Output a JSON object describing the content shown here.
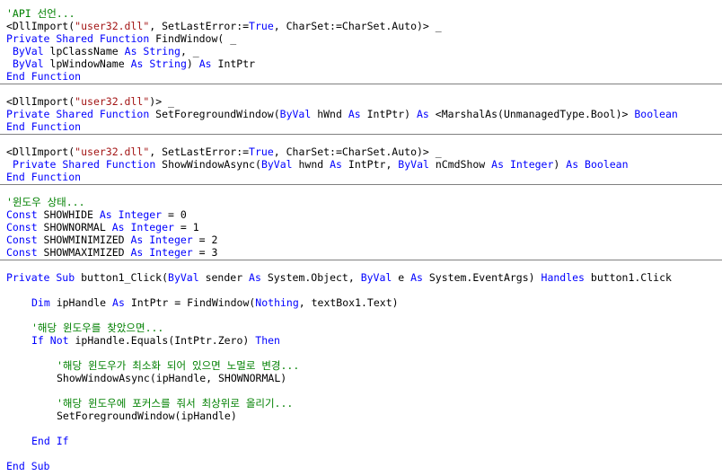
{
  "colors": {
    "background": "#ffffff",
    "keyword": "#0000ff",
    "string": "#a31515",
    "comment": "#008000",
    "text": "#000000",
    "separator": "#808080"
  },
  "lines": [
    {
      "indent": 0,
      "tokens": [
        {
          "t": "cm",
          "v": "'API 선언..."
        }
      ]
    },
    {
      "indent": 0,
      "tokens": [
        {
          "t": "txt",
          "v": "<DllImport("
        },
        {
          "t": "str",
          "v": "\"user32.dll\""
        },
        {
          "t": "txt",
          "v": ", SetLastError:="
        },
        {
          "t": "kw",
          "v": "True"
        },
        {
          "t": "txt",
          "v": ", CharSet:=CharSet.Auto)> _"
        }
      ]
    },
    {
      "indent": 0,
      "tokens": [
        {
          "t": "kw",
          "v": "Private Shared Function"
        },
        {
          "t": "txt",
          "v": " FindWindow( _"
        }
      ]
    },
    {
      "indent": 1,
      "tokens": [
        {
          "t": "kw",
          "v": "ByVal"
        },
        {
          "t": "txt",
          "v": " lpClassName "
        },
        {
          "t": "kw",
          "v": "As String"
        },
        {
          "t": "txt",
          "v": ", _"
        }
      ]
    },
    {
      "indent": 1,
      "tokens": [
        {
          "t": "kw",
          "v": "ByVal"
        },
        {
          "t": "txt",
          "v": " lpWindowName "
        },
        {
          "t": "kw",
          "v": "As String"
        },
        {
          "t": "txt",
          "v": ") "
        },
        {
          "t": "kw",
          "v": "As"
        },
        {
          "t": "txt",
          "v": " IntPtr"
        }
      ]
    },
    {
      "indent": 0,
      "tokens": [
        {
          "t": "kw",
          "v": "End Function"
        }
      ]
    },
    {
      "indent": 0,
      "tokens": []
    },
    {
      "indent": 0,
      "tokens": [
        {
          "t": "txt",
          "v": "<DllImport("
        },
        {
          "t": "str",
          "v": "\"user32.dll\""
        },
        {
          "t": "txt",
          "v": ")> _"
        }
      ]
    },
    {
      "indent": 0,
      "tokens": [
        {
          "t": "kw",
          "v": "Private Shared Function"
        },
        {
          "t": "txt",
          "v": " SetForegroundWindow("
        },
        {
          "t": "kw",
          "v": "ByVal"
        },
        {
          "t": "txt",
          "v": " hWnd "
        },
        {
          "t": "kw",
          "v": "As"
        },
        {
          "t": "txt",
          "v": " IntPtr) "
        },
        {
          "t": "kw",
          "v": "As"
        },
        {
          "t": "txt",
          "v": " <MarshalAs(UnmanagedType.Bool)> "
        },
        {
          "t": "kw",
          "v": "Boolean"
        }
      ]
    },
    {
      "indent": 0,
      "tokens": [
        {
          "t": "kw",
          "v": "End Function"
        }
      ]
    },
    {
      "indent": 0,
      "tokens": []
    },
    {
      "indent": 0,
      "tokens": [
        {
          "t": "txt",
          "v": "<DllImport("
        },
        {
          "t": "str",
          "v": "\"user32.dll\""
        },
        {
          "t": "txt",
          "v": ", SetLastError:="
        },
        {
          "t": "kw",
          "v": "True"
        },
        {
          "t": "txt",
          "v": ", CharSet:=CharSet.Auto)> _"
        }
      ]
    },
    {
      "indent": 1,
      "tokens": [
        {
          "t": "kw",
          "v": "Private Shared Function"
        },
        {
          "t": "txt",
          "v": " ShowWindowAsync("
        },
        {
          "t": "kw",
          "v": "ByVal"
        },
        {
          "t": "txt",
          "v": " hwnd "
        },
        {
          "t": "kw",
          "v": "As"
        },
        {
          "t": "txt",
          "v": " IntPtr, "
        },
        {
          "t": "kw",
          "v": "ByVal"
        },
        {
          "t": "txt",
          "v": " nCmdShow "
        },
        {
          "t": "kw",
          "v": "As Integer"
        },
        {
          "t": "txt",
          "v": ") "
        },
        {
          "t": "kw",
          "v": "As Boolean"
        }
      ]
    },
    {
      "indent": 0,
      "tokens": [
        {
          "t": "kw",
          "v": "End Function"
        }
      ]
    },
    {
      "indent": 0,
      "tokens": []
    },
    {
      "indent": 0,
      "tokens": [
        {
          "t": "cm",
          "v": "'윈도우 상태..."
        }
      ]
    },
    {
      "indent": 0,
      "tokens": [
        {
          "t": "kw",
          "v": "Const"
        },
        {
          "t": "txt",
          "v": " SHOWHIDE "
        },
        {
          "t": "kw",
          "v": "As Integer"
        },
        {
          "t": "txt",
          "v": " = 0"
        }
      ]
    },
    {
      "indent": 0,
      "tokens": [
        {
          "t": "kw",
          "v": "Const"
        },
        {
          "t": "txt",
          "v": " SHOWNORMAL "
        },
        {
          "t": "kw",
          "v": "As Integer"
        },
        {
          "t": "txt",
          "v": " = 1"
        }
      ]
    },
    {
      "indent": 0,
      "tokens": [
        {
          "t": "kw",
          "v": "Const"
        },
        {
          "t": "txt",
          "v": " SHOWMINIMIZED "
        },
        {
          "t": "kw",
          "v": "As Integer"
        },
        {
          "t": "txt",
          "v": " = 2"
        }
      ]
    },
    {
      "indent": 0,
      "tokens": [
        {
          "t": "kw",
          "v": "Const"
        },
        {
          "t": "txt",
          "v": " SHOWMAXIMIZED "
        },
        {
          "t": "kw",
          "v": "As Integer"
        },
        {
          "t": "txt",
          "v": " = 3"
        }
      ]
    },
    {
      "indent": 0,
      "tokens": []
    },
    {
      "indent": 0,
      "tokens": [
        {
          "t": "kw",
          "v": "Private Sub"
        },
        {
          "t": "txt",
          "v": " button1_Click("
        },
        {
          "t": "kw",
          "v": "ByVal"
        },
        {
          "t": "txt",
          "v": " sender "
        },
        {
          "t": "kw",
          "v": "As"
        },
        {
          "t": "txt",
          "v": " System.Object, "
        },
        {
          "t": "kw",
          "v": "ByVal"
        },
        {
          "t": "txt",
          "v": " e "
        },
        {
          "t": "kw",
          "v": "As"
        },
        {
          "t": "txt",
          "v": " System.EventArgs) "
        },
        {
          "t": "kw",
          "v": "Handles"
        },
        {
          "t": "txt",
          "v": " button1.Click"
        }
      ]
    },
    {
      "indent": 0,
      "tokens": []
    },
    {
      "indent": 4,
      "tokens": [
        {
          "t": "kw",
          "v": "Dim"
        },
        {
          "t": "txt",
          "v": " ipHandle "
        },
        {
          "t": "kw",
          "v": "As"
        },
        {
          "t": "txt",
          "v": " IntPtr = FindWindow("
        },
        {
          "t": "kw",
          "v": "Nothing"
        },
        {
          "t": "txt",
          "v": ", textBox1.Text)"
        }
      ]
    },
    {
      "indent": 0,
      "tokens": []
    },
    {
      "indent": 4,
      "tokens": [
        {
          "t": "cm",
          "v": "'해당 윈도우를 찾았으면..."
        }
      ]
    },
    {
      "indent": 4,
      "tokens": [
        {
          "t": "kw",
          "v": "If Not"
        },
        {
          "t": "txt",
          "v": " ipHandle.Equals(IntPtr.Zero) "
        },
        {
          "t": "kw",
          "v": "Then"
        }
      ]
    },
    {
      "indent": 0,
      "tokens": []
    },
    {
      "indent": 8,
      "tokens": [
        {
          "t": "cm",
          "v": "'해당 윈도우가 최소화 되어 있으면 노멀로 변경..."
        }
      ]
    },
    {
      "indent": 8,
      "tokens": [
        {
          "t": "txt",
          "v": "ShowWindowAsync(ipHandle, SHOWNORMAL)"
        }
      ]
    },
    {
      "indent": 0,
      "tokens": []
    },
    {
      "indent": 8,
      "tokens": [
        {
          "t": "cm",
          "v": "'해당 윈도우에 포커스를 줘서 최상위로 올리기..."
        }
      ]
    },
    {
      "indent": 8,
      "tokens": [
        {
          "t": "txt",
          "v": "SetForegroundWindow(ipHandle)"
        }
      ]
    },
    {
      "indent": 0,
      "tokens": []
    },
    {
      "indent": 4,
      "tokens": [
        {
          "t": "kw",
          "v": "End If"
        }
      ]
    },
    {
      "indent": 0,
      "tokens": []
    },
    {
      "indent": 0,
      "tokens": [
        {
          "t": "kw",
          "v": "End Sub"
        }
      ]
    }
  ],
  "separators_after_lines": [
    5,
    9,
    13,
    19
  ]
}
